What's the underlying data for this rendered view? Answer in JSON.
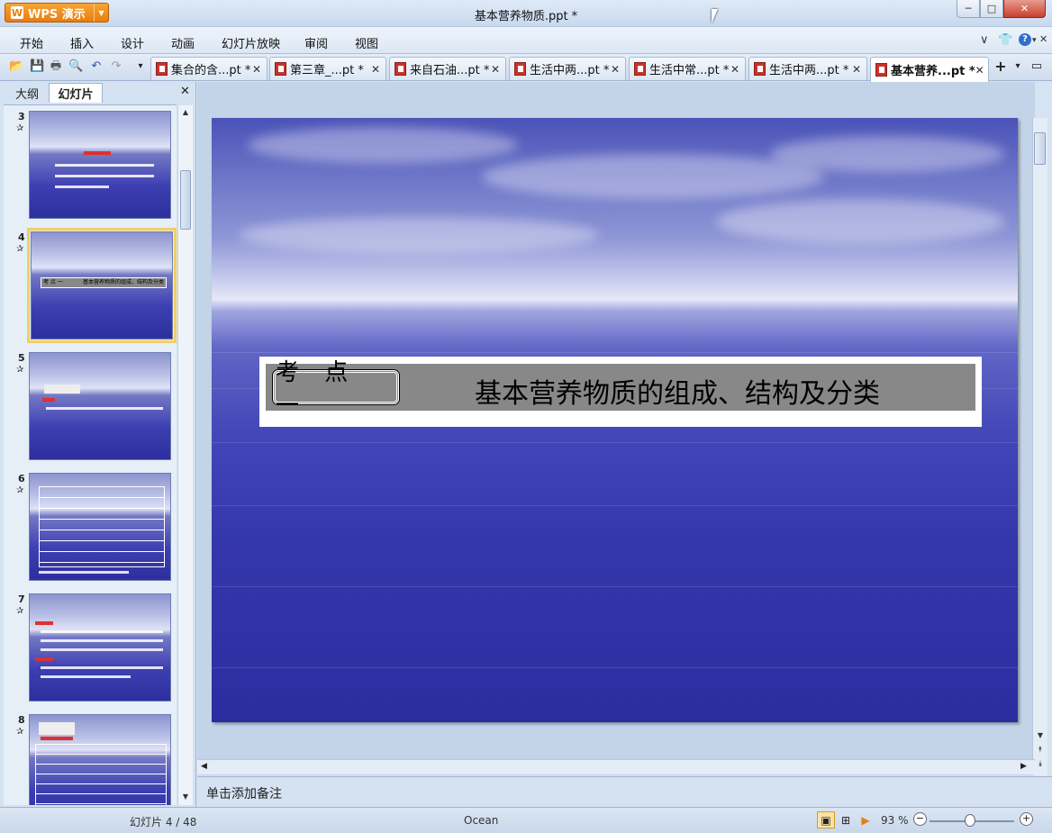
{
  "app": {
    "name": "WPS 演示",
    "logo": "W",
    "title": "基本营养物质.ppt *"
  },
  "window_controls": {
    "minimize": "─",
    "maximize": "□",
    "close": "✕"
  },
  "menu": [
    "开始",
    "插入",
    "设计",
    "动画",
    "幻灯片放映",
    "审阅",
    "视图"
  ],
  "menu_right": {
    "collapse": "∨",
    "skin": "👕",
    "help": "?",
    "help_caret": "▾",
    "close": "✕"
  },
  "quick_access": [
    {
      "icon": "open-icon",
      "glyph": "📂"
    },
    {
      "icon": "save-icon",
      "glyph": "💾"
    },
    {
      "icon": "print-icon",
      "glyph": "🖶"
    },
    {
      "icon": "print-preview-icon",
      "glyph": "🔍"
    },
    {
      "icon": "undo-icon",
      "glyph": "↶"
    },
    {
      "icon": "redo-icon",
      "glyph": "↷"
    },
    {
      "icon": "customize-icon",
      "glyph": "▾"
    }
  ],
  "doc_tabs": [
    {
      "label": "集合的含...pt *",
      "active": false
    },
    {
      "label": "第三章_...pt *",
      "active": false
    },
    {
      "label": "来自石油...pt *",
      "active": false
    },
    {
      "label": "生活中两...pt *",
      "active": false
    },
    {
      "label": "生活中常...pt *",
      "active": false
    },
    {
      "label": "生活中两...pt *",
      "active": false
    },
    {
      "label": "基本营养...pt *",
      "active": true
    }
  ],
  "tab_close": "✕",
  "tab_actions": {
    "new": "+",
    "menu": "▾",
    "layout": "▭"
  },
  "panel": {
    "tab_outline": "大纲",
    "tab_slides": "幻灯片",
    "close": "✕"
  },
  "thumbnails": [
    {
      "num": "3",
      "star": "✰",
      "selected": false
    },
    {
      "num": "4",
      "star": "✰",
      "selected": true
    },
    {
      "num": "5",
      "star": "✰",
      "selected": false
    },
    {
      "num": "6",
      "star": "✰",
      "selected": false
    },
    {
      "num": "7",
      "star": "✰",
      "selected": false
    },
    {
      "num": "8",
      "star": "✰",
      "selected": false
    }
  ],
  "thumb4_text": {
    "tag": "考 点 一",
    "title": "基本营养物质的组成、结构及分类"
  },
  "slide": {
    "tag": "考 点 一",
    "title": "基本营养物质的组成、结构及分类"
  },
  "scroll_arrows": {
    "up": "▲",
    "down": "▼",
    "left": "◀",
    "right": "▶",
    "page_up": "⯭",
    "page_down": "⯯"
  },
  "notes_placeholder": "单击添加备注",
  "status": {
    "slide_counter": "幻灯片 4 / 48",
    "theme": "Ocean",
    "zoom": "93 %",
    "zoom_out": "−",
    "zoom_in": "+"
  },
  "colors": {
    "accent": "#e87d10",
    "selection": "#f3cf62",
    "slide_banner": "#888888"
  }
}
